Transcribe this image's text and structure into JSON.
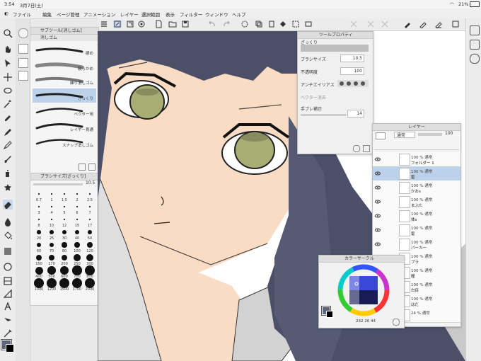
{
  "status": {
    "time": "3:54",
    "date": "3月7日(土)",
    "battery": "21%"
  },
  "menu": [
    "ファイル",
    "編集",
    "ページ管理",
    "アニメーション",
    "レイヤー",
    "選択範囲",
    "表示",
    "フィルター",
    "ウィンドウ",
    "ヘルプ"
  ],
  "subtool": {
    "title": "サブツール[消しゴム]",
    "group": "消しゴム",
    "items": [
      "硬め",
      "軟らかめ",
      "練り消しゴム",
      "ざっくり",
      "ベクター用",
      "レイヤー貫通",
      "スナップ消しゴム"
    ],
    "selected": "ざっくり"
  },
  "brushsize": {
    "title": "ブラシサイズ[ざっくり]",
    "value": "10.5",
    "sizes": [
      "0.7",
      "1",
      "1.5",
      "2",
      "2.5",
      "3",
      "4",
      "5",
      "6",
      "7",
      "8",
      "10",
      "12",
      "15",
      "17",
      "20",
      "25",
      "30",
      "40",
      "50",
      "60",
      "70",
      "80",
      "100",
      "120",
      "150",
      "170",
      "200",
      "250",
      "300",
      "400",
      "500",
      "600",
      "700",
      "800",
      "1000",
      "1200",
      "1500",
      "1700",
      "2000"
    ]
  },
  "toolprop": {
    "title": "ツールプロパティ",
    "tool": "ざっくり",
    "brush_size_label": "ブラシサイズ",
    "brush_size": "10.5",
    "opacity_label": "不透明度",
    "opacity": "100",
    "antialias_label": "アンチエイリアス",
    "vector_label": "ベクター消去",
    "stabilize_label": "手ブレ補正",
    "stabilize": "14"
  },
  "layers": {
    "title": "レイヤー",
    "blend": "通常",
    "opacity": "100",
    "rows": [
      {
        "percent": "100 %",
        "mode": "通常",
        "name": "フォルダー 1",
        "folder": true
      },
      {
        "percent": "100 %",
        "mode": "通常",
        "name": "髪",
        "selected": true
      },
      {
        "percent": "100 %",
        "mode": "通常",
        "name": "かおs"
      },
      {
        "percent": "100 %",
        "mode": "通常",
        "name": "まぶた"
      },
      {
        "percent": "100 %",
        "mode": "通常",
        "name": "体s"
      },
      {
        "percent": "100 %",
        "mode": "通常",
        "name": "髪"
      },
      {
        "percent": "100 %",
        "mode": "通常",
        "name": "パーカー"
      },
      {
        "percent": "100 %",
        "mode": "通常",
        "name": "ブラ"
      },
      {
        "percent": "100 %",
        "mode": "通常",
        "name": "瞳"
      },
      {
        "percent": "100 %",
        "mode": "通常",
        "name": "白目"
      },
      {
        "percent": "100 %",
        "mode": "通常",
        "name": "はだ"
      },
      {
        "percent": "24 %",
        "mode": "通常",
        "name": ""
      }
    ]
  },
  "color": {
    "title": "カラーサークル",
    "h": "232",
    "s": "26",
    "v": "44",
    "main": "#5d6480",
    "sub": "#000000"
  },
  "colors": {
    "hair": "#4b5068",
    "skin": "#fadbc4",
    "eye": "#a8ad74",
    "accent": "#bcd2ea"
  }
}
